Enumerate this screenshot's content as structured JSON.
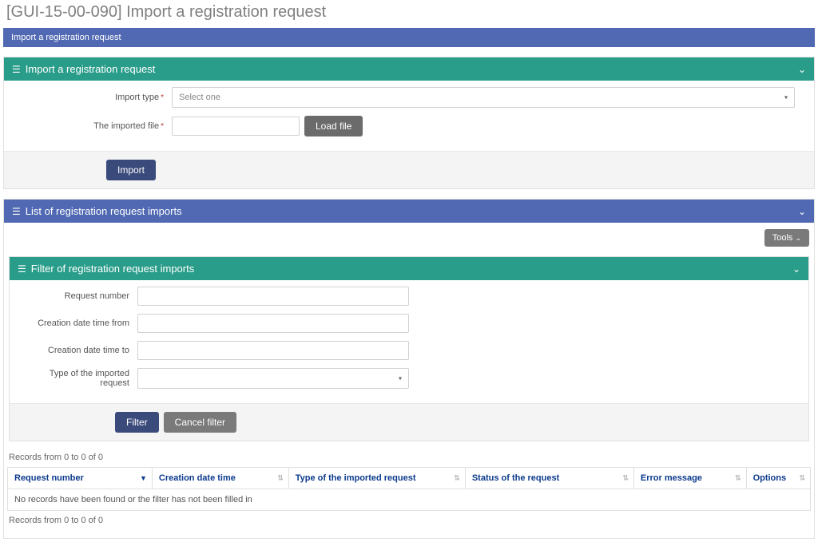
{
  "page": {
    "title": "[GUI-15-00-090] Import a registration request",
    "breadcrumb": "Import a registration request"
  },
  "panel_import": {
    "title": "Import a registration request",
    "fields": {
      "import_type_label": "Import type",
      "import_type_placeholder": "Select one",
      "imported_file_label": "The imported file",
      "load_file_btn": "Load file"
    },
    "import_btn": "Import"
  },
  "panel_list": {
    "title": "List of registration request imports",
    "tools_btn": "Tools"
  },
  "panel_filter": {
    "title": "Filter of registration request imports",
    "fields": {
      "request_number_label": "Request number",
      "creation_from_label": "Creation date time from",
      "creation_to_label": "Creation date time to",
      "type_imported_label": "Type of the imported request"
    },
    "filter_btn": "Filter",
    "cancel_btn": "Cancel filter"
  },
  "table": {
    "records_text_top": "Records from 0 to 0 of 0",
    "records_text_bottom": "Records from 0 to 0 of 0",
    "columns": {
      "c1": "Request number",
      "c2": "Creation date time",
      "c3": "Type of the imported request",
      "c4": "Status of the request",
      "c5": "Error message",
      "c6": "Options"
    },
    "empty": "No records have been found or the filter has not been filled in"
  }
}
